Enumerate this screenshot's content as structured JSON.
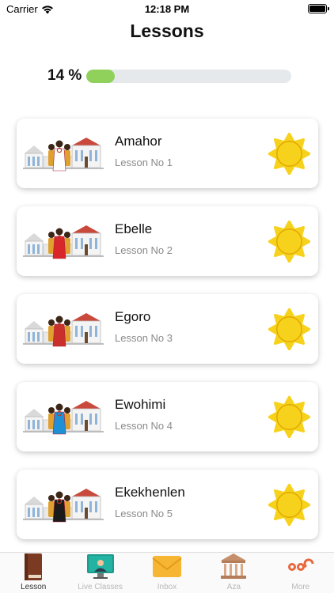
{
  "status": {
    "carrier": "Carrier",
    "time": "12:18 PM"
  },
  "header": {
    "title": "Lessons"
  },
  "progress": {
    "label": "14 %",
    "fraction": 0.14
  },
  "lessons": [
    {
      "title": "Amahor",
      "subtitle": "Lesson No 1",
      "figure_color": "#ffffff"
    },
    {
      "title": "Ebelle",
      "subtitle": "Lesson No 2",
      "figure_color": "#d8262a"
    },
    {
      "title": "Egoro",
      "subtitle": "Lesson No 3",
      "figure_color": "#c9302c"
    },
    {
      "title": "Ewohimi",
      "subtitle": "Lesson No 4",
      "figure_color": "#1f8fd6"
    },
    {
      "title": "Ekekhenlen",
      "subtitle": "Lesson No 5",
      "figure_color": "#1b1b1b"
    }
  ],
  "tabs": [
    {
      "label": "Lesson",
      "icon": "book-icon",
      "active": true
    },
    {
      "label": "Live Classes",
      "icon": "live-class-icon",
      "active": false
    },
    {
      "label": "Inbox",
      "icon": "envelope-icon",
      "active": false
    },
    {
      "label": "Aza",
      "icon": "bank-building-icon",
      "active": false
    },
    {
      "label": "More",
      "icon": "more-icon",
      "active": false
    }
  ],
  "colors": {
    "accent_green": "#8fd15a",
    "sun_yellow": "#f7d21c",
    "sun_stroke": "#e0a800"
  }
}
